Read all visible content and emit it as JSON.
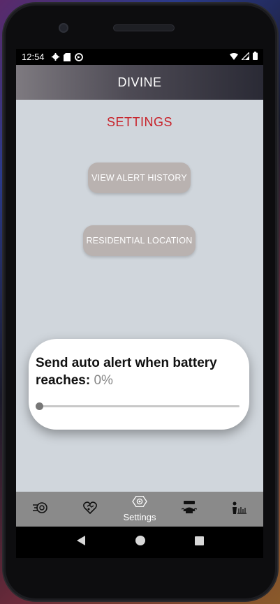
{
  "status_bar": {
    "time": "12:54",
    "icons_left": [
      "settings-gear-icon",
      "sd-card-icon",
      "sync-icon"
    ],
    "icons_right": [
      "wifi-icon",
      "signal-icon",
      "battery-icon"
    ]
  },
  "app_bar": {
    "title": "DIVINE"
  },
  "main": {
    "title": "SETTINGS",
    "view_alert_history_label": "VIEW ALERT HISTORY",
    "residential_location_label": "RESIDENTIAL LOCATION"
  },
  "battery_card": {
    "label": "Send auto alert when battery reaches:",
    "value": "0%",
    "slider_level_percent": 0
  },
  "bottom_nav": {
    "items": [
      {
        "icon": "alert-speed-icon",
        "label": ""
      },
      {
        "icon": "heart-map-icon",
        "label": ""
      },
      {
        "icon": "settings-icon",
        "label": "Settings"
      },
      {
        "icon": "help-me-icon",
        "label": ""
      },
      {
        "icon": "info-person-icon",
        "label": ""
      }
    ]
  },
  "colors": {
    "accent": "#c8222a",
    "button": "#b9b2b0",
    "content_bg": "#d0d6dc",
    "nav_bg": "#8a8a8a"
  }
}
